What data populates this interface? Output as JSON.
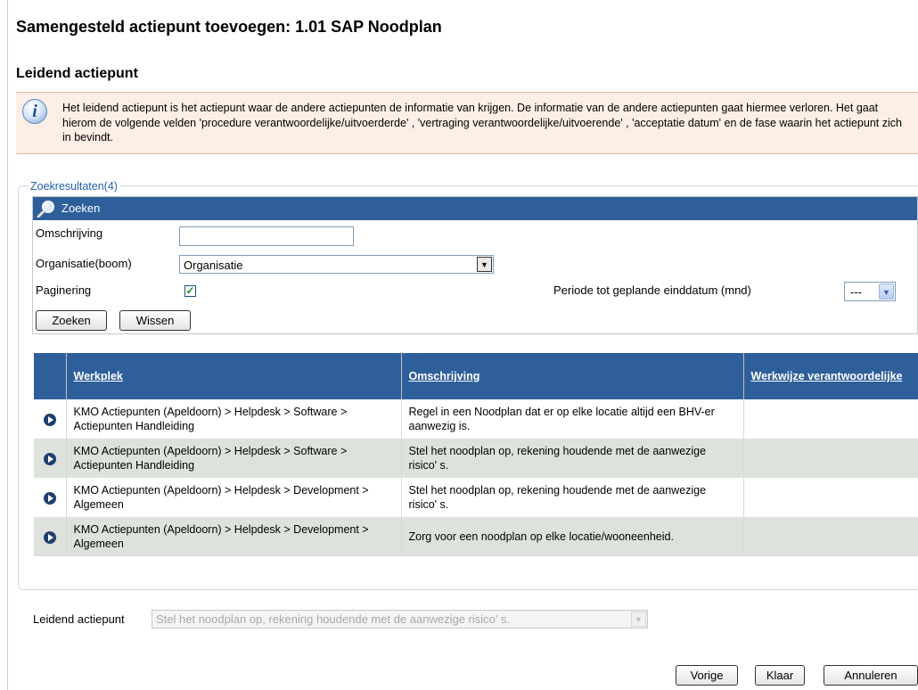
{
  "page": {
    "title": "Samengesteld actiepunt toevoegen: 1.01 SAP Noodplan",
    "section_title": "Leidend actiepunt"
  },
  "info": {
    "icon": "info-icon",
    "text": "Het leidend actiepunt is het actiepunt waar de andere actiepunten de informatie van krijgen. De informatie van de andere actiepunten gaat hiermee verloren. Het gaat hierom de volgende velden 'procedure verantwoordelijke/uitvoerderde' , 'vertraging verantwoordelijke/uitvoerende' , 'acceptatie datum' en de fase waarin het actiepunt zich in bevindt."
  },
  "results": {
    "legend": "Zoekresultaten(4)"
  },
  "search": {
    "header": "Zoeken",
    "omschrijving_label": "Omschrijving",
    "omschrijving_value": "",
    "organisatie_label": "Organisatie(boom)",
    "organisatie_value": "Organisatie",
    "paginering_label": "Paginering",
    "paginering_checked": true,
    "periode_label": "Periode tot geplande einddatum (mnd)",
    "periode_value": "---",
    "zoeken_button": "Zoeken",
    "wissen_button": "Wissen"
  },
  "table": {
    "columns": [
      "Werkplek",
      "Omschrijving",
      "Werkwijze verantwoordelijke"
    ],
    "rows": [
      {
        "werkplek": "KMO Actiepunten (Apeldoorn) > Helpdesk > Software > Actiepunten Handleiding",
        "omschrijving": "Regel in een Noodplan dat er op elke locatie altijd een BHV-er aanwezig is.",
        "werkwijze": ""
      },
      {
        "werkplek": "KMO Actiepunten (Apeldoorn) > Helpdesk > Software > Actiepunten Handleiding",
        "omschrijving": "Stel het noodplan op, rekening houdende met de aanwezige risico' s.",
        "werkwijze": ""
      },
      {
        "werkplek": "KMO Actiepunten (Apeldoorn) > Helpdesk > Development > Algemeen",
        "omschrijving": "Stel het noodplan op, rekening houdende met de aanwezige risico' s.",
        "werkwijze": ""
      },
      {
        "werkplek": "KMO Actiepunten (Apeldoorn) > Helpdesk > Development > Algemeen",
        "omschrijving": "Zorg voor een noodplan op elke locatie/wooneenheid.",
        "werkwijze": ""
      }
    ]
  },
  "leidend": {
    "label": "Leidend actiepunt",
    "value": "Stel het noodplan op, rekening houdende met de aanwezige risico' s."
  },
  "footer": {
    "vorige": "Vorige",
    "klaar": "Klaar",
    "annuleren": "Annuleren"
  },
  "colors": {
    "header_blue": "#2f5f9a",
    "info_bg": "#fdeee6",
    "alt_row": "#dde3dc"
  }
}
